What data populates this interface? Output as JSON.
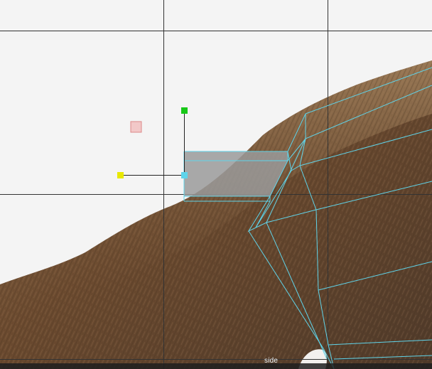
{
  "viewport": {
    "view_name": "side",
    "background_color": "#f4f4f4",
    "grid_color": "#333333",
    "wireframe_color": "#5fd4ea",
    "fur_colors": [
      "#6b4a2f",
      "#4f3a2a",
      "#8a6a4a",
      "#a58560"
    ]
  },
  "manipulator": {
    "y_axis_handle_color": "#18c818",
    "z_axis_handle_color": "#e8e800",
    "center_handle_color": "#5fd4ea",
    "plane_handle_color": "#f2c8c8",
    "selected_face_color": "#9a9a9a"
  }
}
